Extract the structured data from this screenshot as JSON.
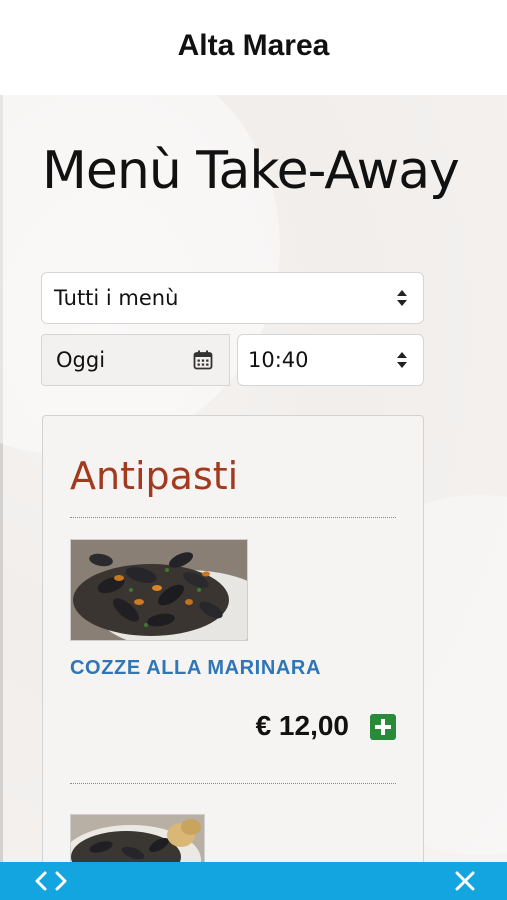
{
  "header": {
    "title": "Alta Marea"
  },
  "page": {
    "title": "Menù Take-Away"
  },
  "filters": {
    "menu_select": "Tutti i menù",
    "date_value": "Oggi",
    "time_select": "10:40"
  },
  "menu": {
    "section_title": "Antipasti",
    "items": [
      {
        "name": "COZZE ALLA MARINARA",
        "price": "€ 12,00"
      }
    ]
  },
  "colors": {
    "accent_bar": "#12a5df",
    "section_title": "#a23a1e",
    "dish_name": "#2e76b8",
    "add_button": "#2a8a3a"
  },
  "icons": {
    "calendar": "calendar-icon",
    "add": "plus-square-icon",
    "nav": "chevron-left-right-icon",
    "close": "close-icon"
  }
}
